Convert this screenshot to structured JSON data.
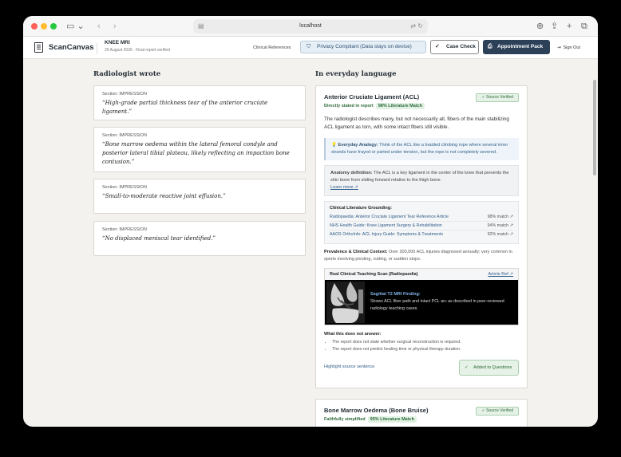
{
  "browser": {
    "url": "localhost",
    "icons": {
      "sidebar": "sidebar-icon",
      "back": "chevron-left-icon",
      "forward": "chevron-right-icon",
      "download": "download-icon",
      "share": "share-icon",
      "new_tab": "plus-icon",
      "tabs": "tabs-icon",
      "reload": "reload-icon",
      "translate": "translate-icon"
    }
  },
  "header": {
    "brand": "ScanCanvas",
    "study_title": "KNEE MRI",
    "study_subtitle": "25 August 2026 · Final report verified",
    "clinical_references": "Clinical References",
    "privacy_badge": "Privacy Compliant (Data stays on device)",
    "case_check": "Case Check",
    "appointment_pack": "Appointment Pack",
    "sign_out": "Sign Out"
  },
  "left": {
    "title": "Radiologist wrote",
    "impressions": [
      {
        "section": "Section: IMPRESSION",
        "quote": "“High-grade partial thickness tear of the anterior cruciate ligament.”"
      },
      {
        "section": "Section: IMPRESSION",
        "quote": "“Bone marrow oedema within the lateral femoral condyle and posterior lateral tibial plateau, likely reflecting an impaction bone contusion.”"
      },
      {
        "section": "Section: IMPRESSION",
        "quote": "“Small-to-moderate reactive joint effusion.”"
      },
      {
        "section": "Section: IMPRESSION",
        "quote": "“No displaced meniscal tear identified.”"
      }
    ]
  },
  "right": {
    "title": "In everyday language",
    "cards": [
      {
        "title": "Anterior Cruciate Ligament (ACL)",
        "verified": "Source Verified",
        "status": "Directly stated in report",
        "literature_match": "98% Literature Match",
        "description": "The radiologist describes many, but not necessarily all, fibers of the main stabilizing ACL ligament as torn, with some intact fibers still visible.",
        "analogy_label": "Everyday Analogy:",
        "analogy_text": "Think of the ACL like a braided climbing rope where several inner strands have frayed or parted under tension, but the rope is not completely severed.",
        "anatomy_label": "Anatomy definition:",
        "anatomy_text": "The ACL is a key ligament in the center of the knee that prevents the shin bone from sliding forward relative to the thigh bone.",
        "learn_more": "Learn more",
        "grounding_title": "Clinical Literature Grounding:",
        "sources": [
          {
            "name": "Radiopaedia: Anterior Cruciate Ligament Tear Reference Article",
            "match": "98% match"
          },
          {
            "name": "NHS Health Guide: Knee Ligament Surgery & Rehabilitation",
            "match": "94% match"
          },
          {
            "name": "AAOS OrthoInfo: ACL Injury Guide: Symptoms & Treatments",
            "match": "92% match"
          }
        ],
        "prevalence_label": "Prevalence & Clinical Context:",
        "prevalence_text": "Over 200,000 ACL injuries diagnosed annually; very common in sports involving pivoting, cutting, or sudden stops.",
        "scan_title": "Real Clinical Teaching Scan (Radiopaedia)",
        "article_ref": "Article Ref",
        "finding_title": "Sagittal T2 MRI Finding:",
        "finding_text": "Shows ACL fiber path and intact PCL arc as described in peer-reviewed radiology teaching cases.",
        "not_answer_title": "What this does not answer:",
        "not_answer": [
          "The report does not state whether surgical reconstruction is required.",
          "The report does not predict healing time or physical therapy duration."
        ],
        "highlight": "Highlight source sentence",
        "added": "Added to Questions"
      },
      {
        "title": "Bone Marrow Oedema (Bone Bruise)",
        "verified": "Source Verified",
        "status": "Faithfully simplified",
        "literature_match": "95% Literature Match"
      }
    ]
  }
}
